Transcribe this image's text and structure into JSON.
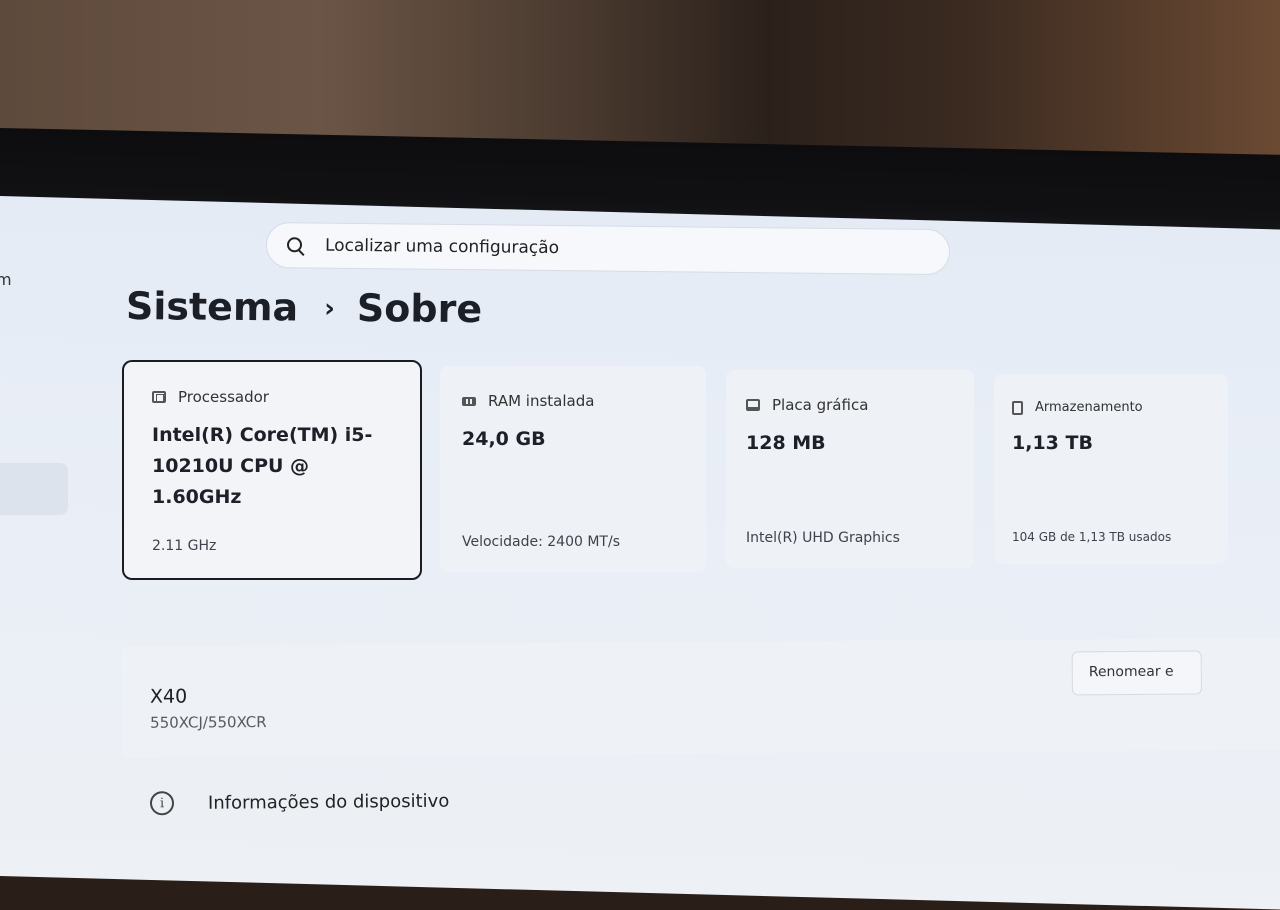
{
  "search": {
    "placeholder": "Localizar uma configuração"
  },
  "breadcrumb": {
    "parent": "Sistema",
    "separator": "›",
    "current": "Sobre"
  },
  "sidebar": {
    "partial_label": "m"
  },
  "specs": [
    {
      "icon": "cpu-icon",
      "label": "Processador",
      "value": "Intel(R) Core(TM) i5-10210U CPU @ 1.60GHz",
      "sub": "2.11 GHz"
    },
    {
      "icon": "ram-icon",
      "label": "RAM instalada",
      "value": "24,0 GB",
      "sub": "Velocidade: 2400 MT/s"
    },
    {
      "icon": "gpu-icon",
      "label": "Placa gráfica",
      "value": "128 MB",
      "sub": "Intel(R) UHD Graphics"
    },
    {
      "icon": "storage-icon",
      "label": "Armazenamento",
      "value": "1,13 TB",
      "sub": "104 GB de 1,13 TB usados"
    }
  ],
  "device": {
    "name": "X40",
    "model": "550XCJ/550XCR",
    "rename_label": "Renomear e"
  },
  "info": {
    "label": "Informações do dispositivo",
    "icon": "info-icon"
  }
}
